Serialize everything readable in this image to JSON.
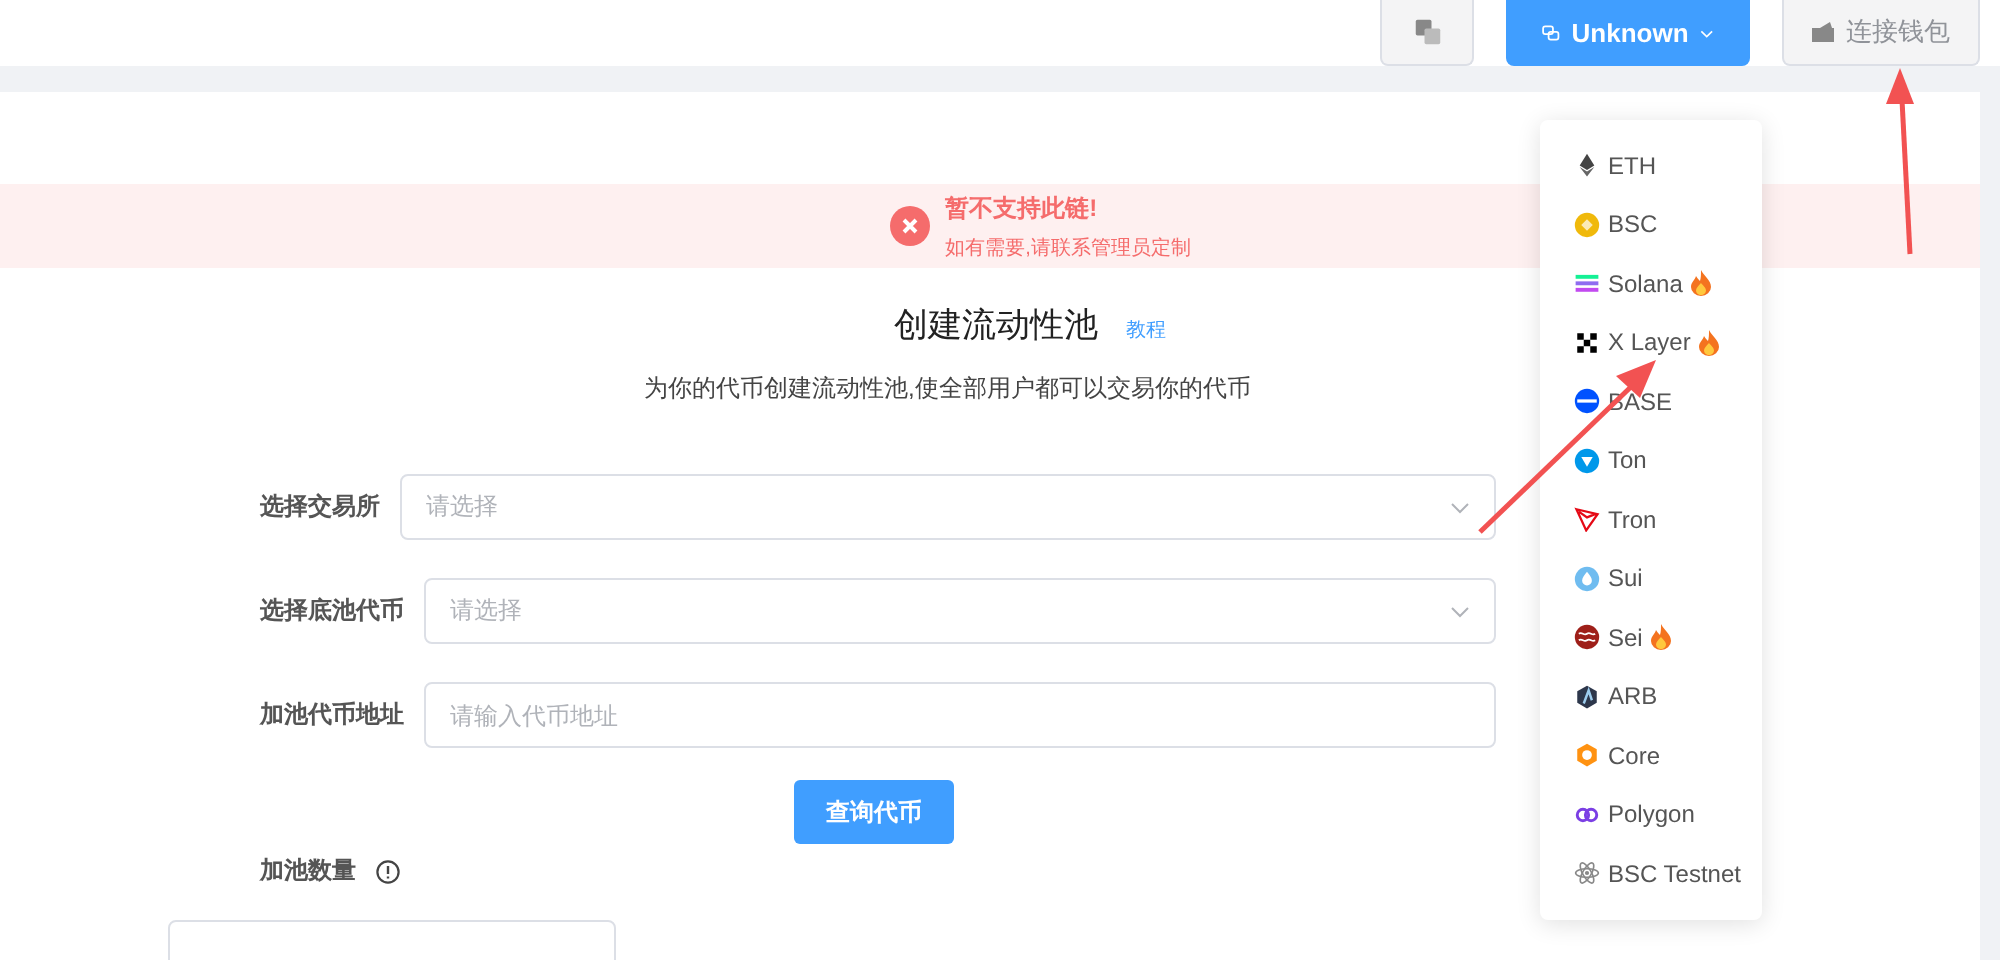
{
  "header": {
    "network_button": {
      "label": "Unknown",
      "expanded": true
    },
    "wallet_button": {
      "label": "连接钱包"
    }
  },
  "network_menu": [
    {
      "label": "ETH",
      "hot": false
    },
    {
      "label": "BSC",
      "hot": false
    },
    {
      "label": "Solana",
      "hot": true
    },
    {
      "label": "X Layer",
      "hot": true
    },
    {
      "label": "BASE",
      "hot": false
    },
    {
      "label": "Ton",
      "hot": false
    },
    {
      "label": "Tron",
      "hot": false
    },
    {
      "label": "Sui",
      "hot": false
    },
    {
      "label": "Sei",
      "hot": true
    },
    {
      "label": "ARB",
      "hot": false
    },
    {
      "label": "Core",
      "hot": false
    },
    {
      "label": "Polygon",
      "hot": false
    },
    {
      "label": "BSC Testnet",
      "hot": false
    }
  ],
  "alert": {
    "title": "暂不支持此链!",
    "message": "如有需要,请联系管理员定制"
  },
  "page": {
    "title": "创建流动性池",
    "tutorial_link": "教程",
    "subtitle": "为你的代币创建流动性池,使全部用户都可以交易你的代币"
  },
  "form": {
    "fields": [
      {
        "kind": "select",
        "label": "选择交易所",
        "placeholder": "请选择"
      },
      {
        "kind": "select",
        "label": "选择底池代币",
        "placeholder": "请选择"
      },
      {
        "kind": "input",
        "label": "加池代币地址",
        "placeholder": "请输入代币地址"
      }
    ],
    "query_button": "查询代币",
    "amount_label": "加池数量"
  }
}
